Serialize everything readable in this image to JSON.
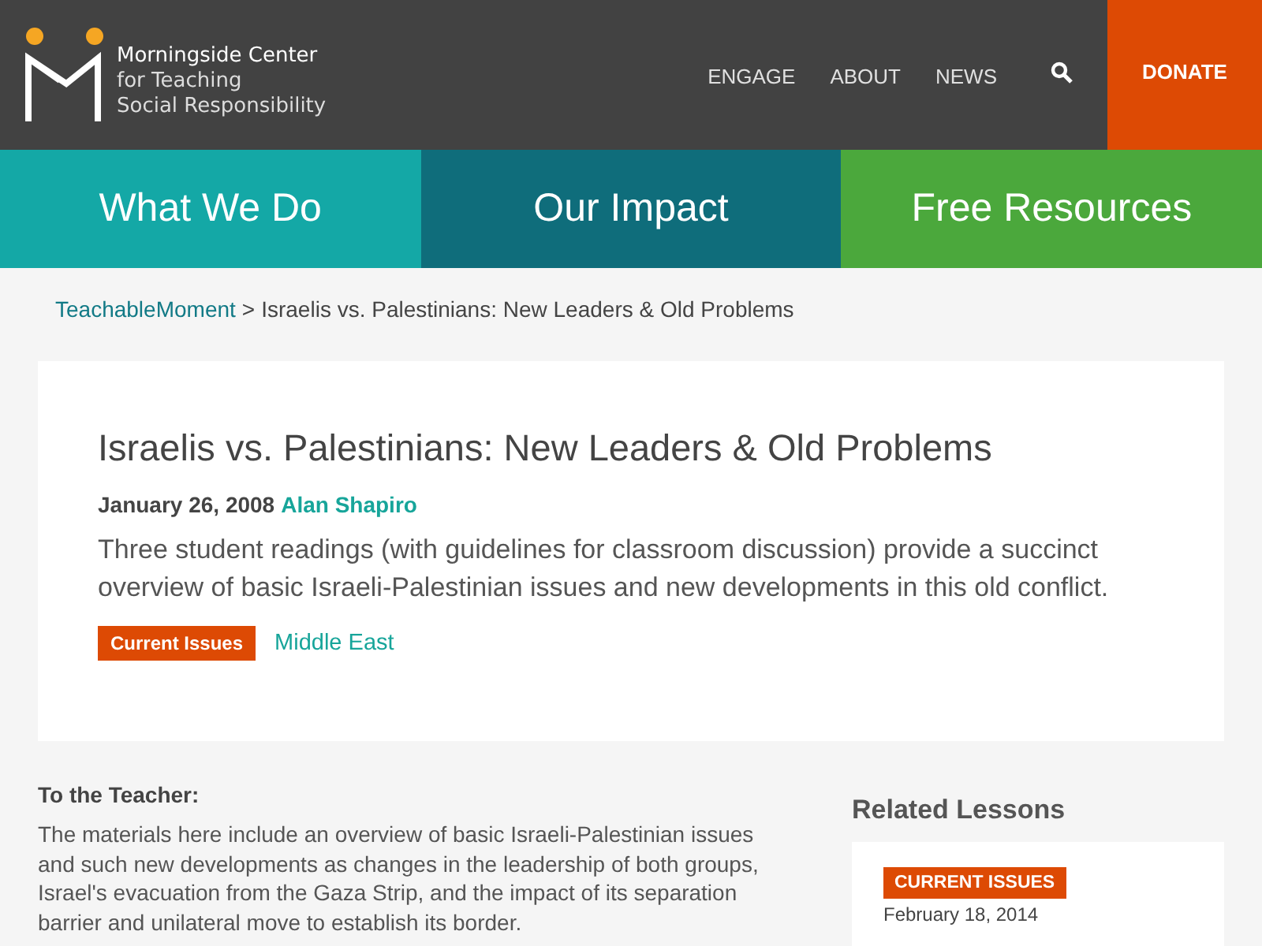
{
  "header": {
    "logo_lines": [
      "Morningside Center",
      "for Teaching",
      "Social Responsibility"
    ],
    "nav": [
      "ENGAGE",
      "ABOUT",
      "NEWS"
    ],
    "donate": "DONATE"
  },
  "sections": [
    {
      "label": "What We Do",
      "color": "#14a8a6"
    },
    {
      "label": "Our Impact",
      "color": "#0f6d7b"
    },
    {
      "label": "Free Resources",
      "color": "#4ba83c"
    }
  ],
  "breadcrumb": {
    "link": "TeachableMoment",
    "separator": ">",
    "current": "Israelis vs. Palestinians: New Leaders & Old Problems"
  },
  "article": {
    "title": "Israelis vs. Palestinians: New Leaders & Old Problems",
    "date": "January 26, 2008",
    "author": "Alan Shapiro",
    "summary": "Three student readings (with guidelines for classroom discussion) provide a succinct overview of basic Israeli-Palestinian issues and new developments in this old conflict.",
    "tags": [
      {
        "label": "Current Issues",
        "kind": "badge"
      },
      {
        "label": "Middle East",
        "kind": "link"
      }
    ]
  },
  "teacher": {
    "heading": "To the Teacher:",
    "text": "The materials here include an overview of basic Israeli-Palestinian issues and such new developments as changes in the leadership of both groups, Israel's evacuation from the Gaza Strip, and the impact of its separation barrier and unilateral move to establish its border."
  },
  "related": {
    "heading": "Related Lessons",
    "items": [
      {
        "tag": "CURRENT ISSUES",
        "date": "February 18, 2014"
      }
    ]
  }
}
